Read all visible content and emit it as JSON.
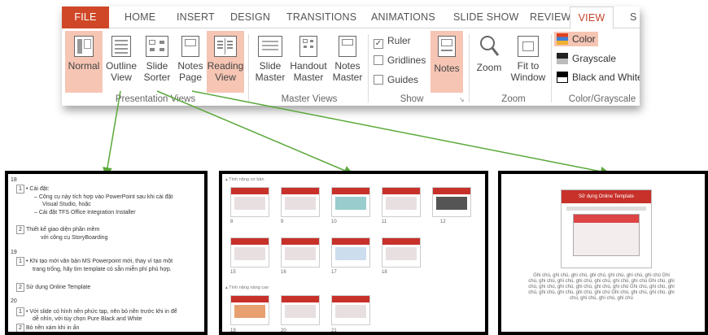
{
  "tabs": [
    "FILE",
    "HOME",
    "INSERT",
    "DESIGN",
    "TRANSITIONS",
    "ANIMATIONS",
    "SLIDE SHOW",
    "REVIEW",
    "VIEW",
    "S"
  ],
  "presentation_views": {
    "buttons": [
      {
        "line1": "Normal",
        "line2": ""
      },
      {
        "line1": "Outline",
        "line2": "View"
      },
      {
        "line1": "Slide",
        "line2": "Sorter"
      },
      {
        "line1": "Notes",
        "line2": "Page"
      },
      {
        "line1": "Reading",
        "line2": "View"
      }
    ],
    "label": "Presentation Views"
  },
  "master_views": {
    "buttons": [
      {
        "line1": "Slide",
        "line2": "Master"
      },
      {
        "line1": "Handout",
        "line2": "Master"
      },
      {
        "line1": "Notes",
        "line2": "Master"
      }
    ],
    "label": "Master Views"
  },
  "show": {
    "ruler": "Ruler",
    "ruler_check": "✓",
    "gridlines": "Gridlines",
    "guides": "Guides",
    "notes": "Notes",
    "label": "Show"
  },
  "zoom": {
    "zoom": "Zoom",
    "fit1": "Fit to",
    "fit2": "Window",
    "label": "Zoom"
  },
  "color": {
    "color": "Color",
    "grayscale": "Grayscale",
    "bw": "Black and White",
    "label": "Color/Grayscale"
  },
  "outline": {
    "s18": "18",
    "s19": "19",
    "s20": "20",
    "l1": "• Cài đặt:",
    "l2": "– Công cụ này  tích hợp vào PowerPoint sau khi cài đặt",
    "l3": "Visual Studio, hoặc",
    "l4": "– Cài đặt TFS Office Integration Installer",
    "l5": "Thiết kế giao diện phần mềm",
    "l6": "với công cụ StoryBoarding",
    "l7": "• Khi tạo mới văn bản MS Powerpoint mới, thay vì tạo một",
    "l8": "trang trống, hãy tìm template có sẵn miễn phí phù hợp.",
    "l9": "Sử dụng Online Template",
    "l10": "• Với slide có hình nền phức tạp, nên bỏ nền trước khi in để",
    "l11": "dễ nhìn, với tùy chọn Pure Black and White",
    "l12": "Bỏ nền xám khi in ấn"
  },
  "sorter": {
    "sec1": "▴ Tính năng cơ bản",
    "sec2": "▴ Tính năng nâng cao",
    "row1": [
      "8",
      "9",
      "10",
      "11",
      "12"
    ],
    "row2": [
      "15",
      "16",
      "17",
      "18"
    ],
    "row3": [
      "19",
      "20",
      "21"
    ]
  },
  "notespage": {
    "title": "Sử dụng Online Template",
    "note": "Ghi chú, ghi chú, ghi chú, ghi chú, ghi chú, ghi chú, ghi chú Ghi chú, ghi chú, ghi chú, ghi chú, ghi chú, ghi chú, ghi chú Ghi chú, ghi chú, ghi chú, ghi chú, ghi chú, ghi chú, ghi chú Ghi chú, ghi chú, ghi chú, ghi chú, ghi chú, ghi chú, ghi chú Ghi chú, ghi chú, ghi chú, ghi chú, ghi chú, ghi chú, ghi chú"
  }
}
